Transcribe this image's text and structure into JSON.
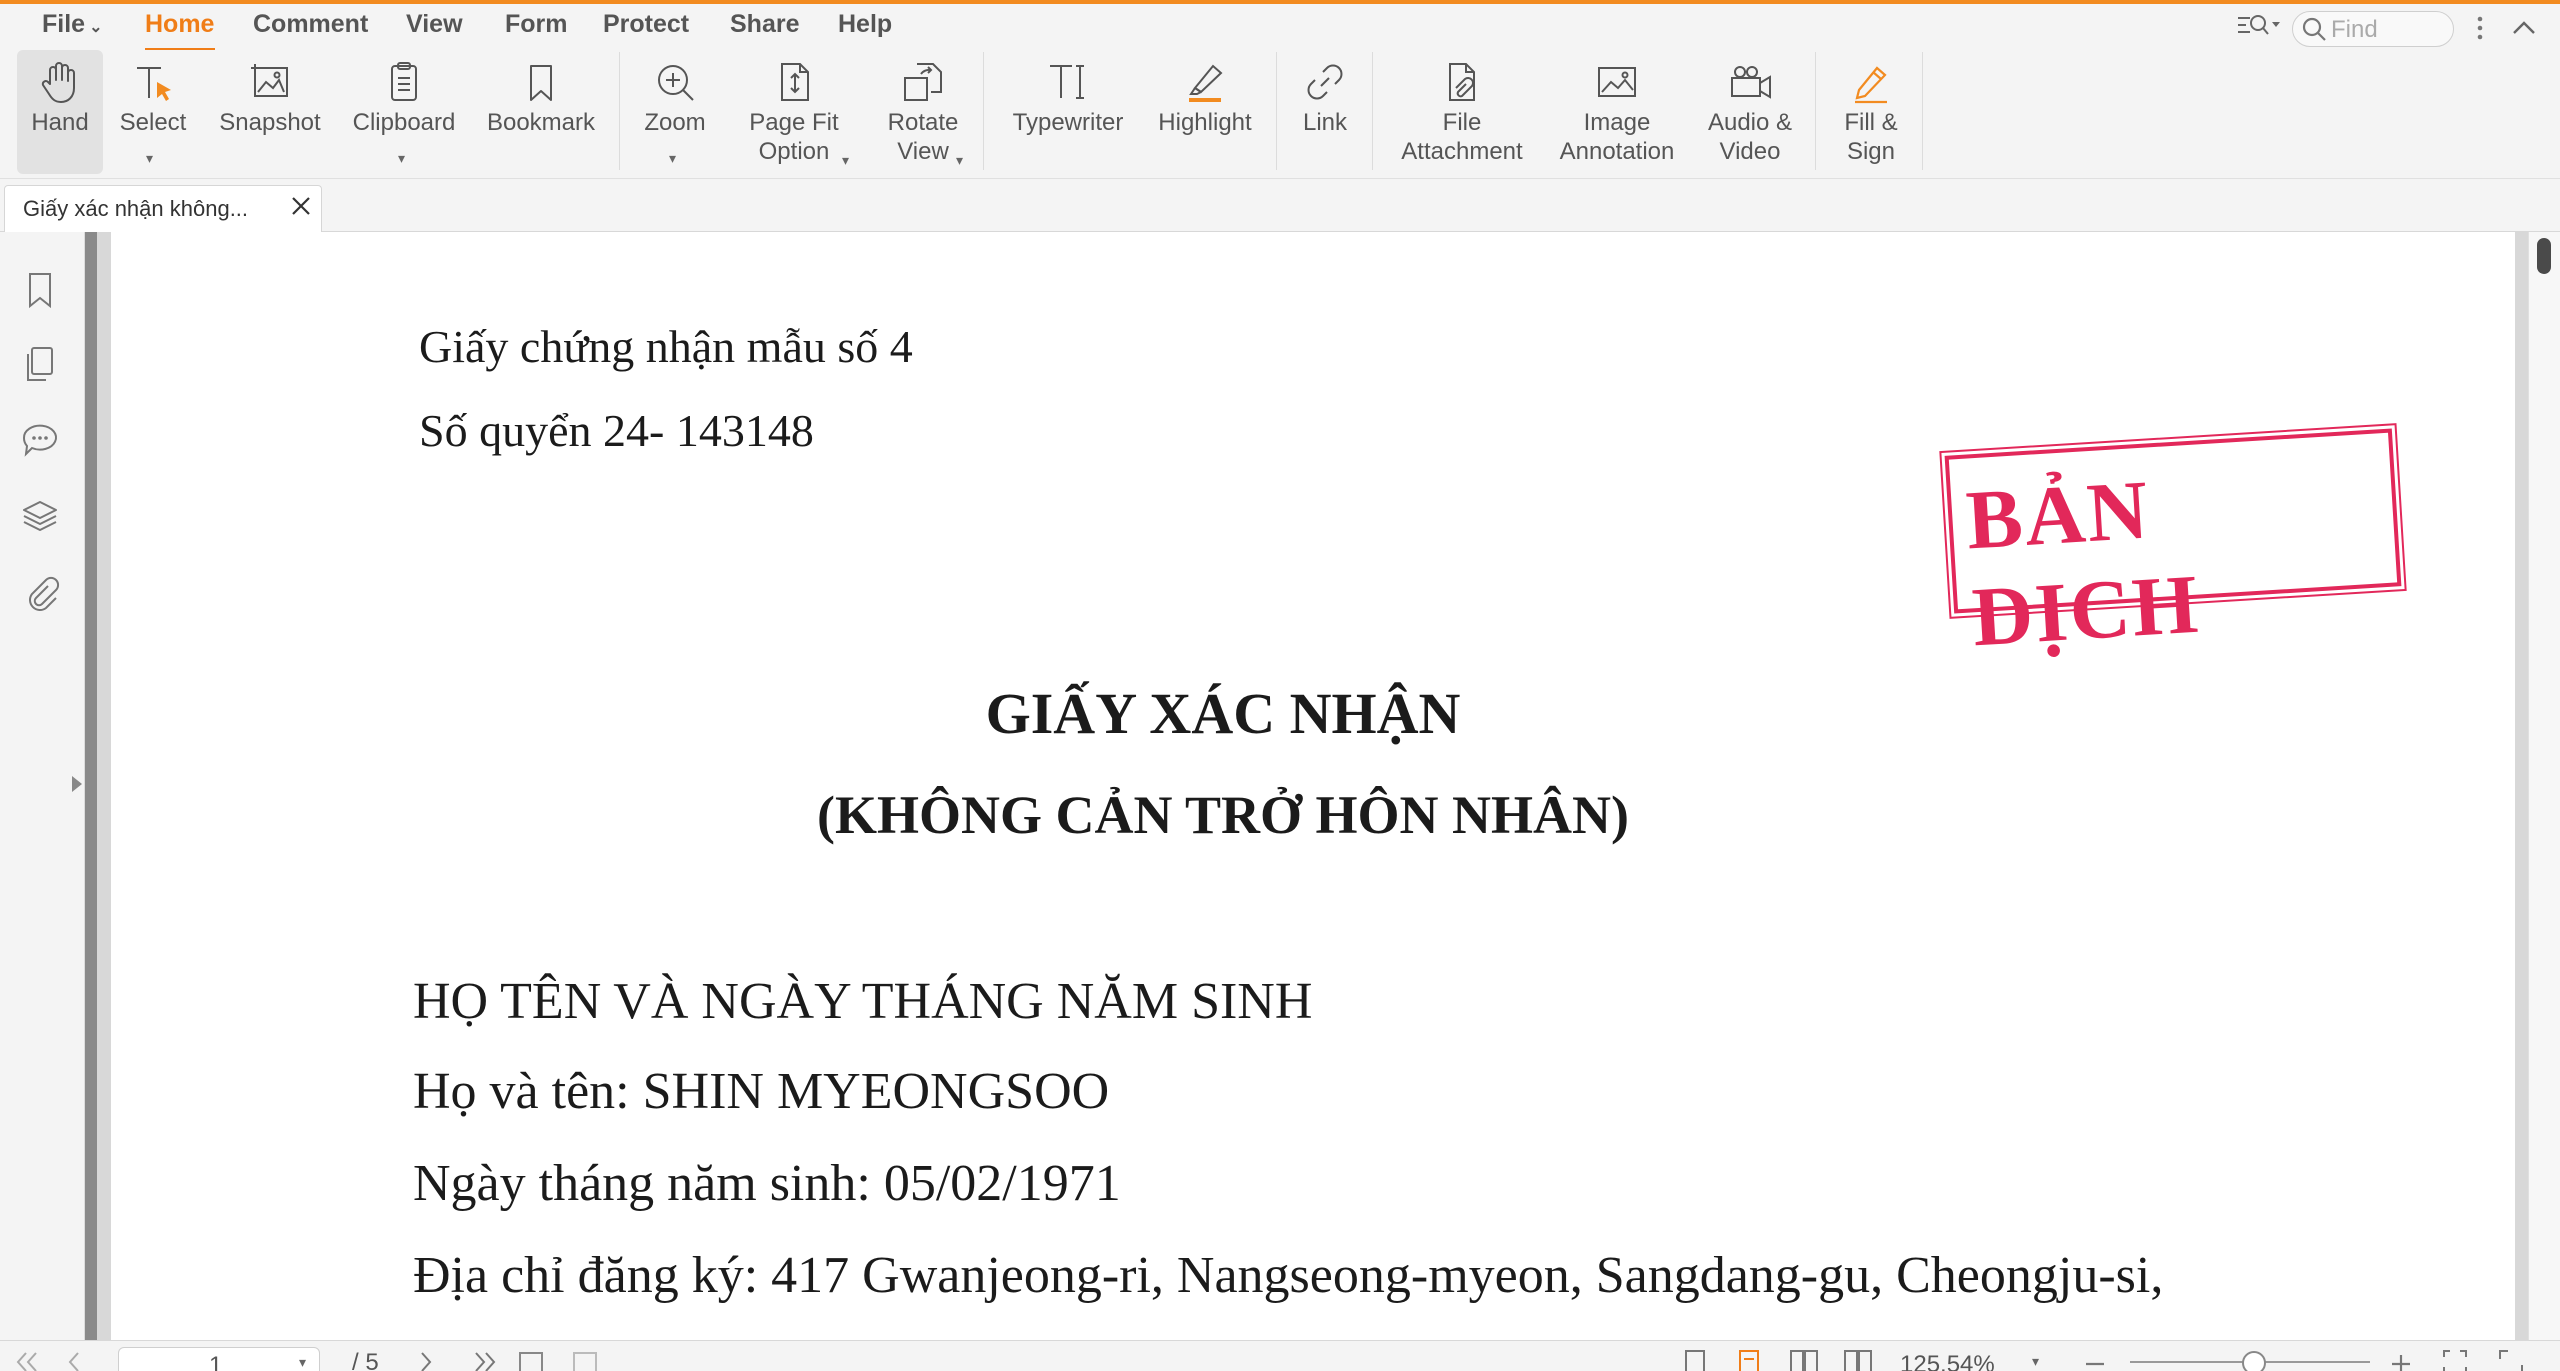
{
  "menu": {
    "file": "File",
    "items": [
      "Home",
      "Comment",
      "View",
      "Form",
      "Protect",
      "Share",
      "Help"
    ],
    "active": "Home"
  },
  "search": {
    "placeholder": "Find"
  },
  "ribbon": {
    "hand": "Hand",
    "select": "Select",
    "snapshot": "Snapshot",
    "clipboard": "Clipboard",
    "bookmark": "Bookmark",
    "zoom": "Zoom",
    "page_fit_1": "Page Fit",
    "page_fit_2": "Option",
    "rotate_1": "Rotate",
    "rotate_2": "View",
    "typewriter": "Typewriter",
    "highlight": "Highlight",
    "link": "Link",
    "file_attach_1": "File",
    "file_attach_2": "Attachment",
    "image_annot_1": "Image",
    "image_annot_2": "Annotation",
    "audio_1": "Audio &",
    "audio_2": "Video",
    "fill_sign_1": "Fill &",
    "fill_sign_2": "Sign"
  },
  "tab": {
    "title": "Giấy xác nhận không..."
  },
  "document": {
    "form_no": "Giấy chứng nhận mẫu số 4",
    "book_no": "Số quyển 24- 143148",
    "stamp": "BẢN DỊCH",
    "title": "GIẤY XÁC NHẬN",
    "subtitle": "(KHÔNG CẢN TRỞ HÔN NHÂN)",
    "section": "HỌ TÊN VÀ NGÀY THÁNG NĂM SINH",
    "name_line": "Họ và tên:  SHIN MYEONGSOO",
    "dob_line": "Ngày tháng năm sinh: 05/02/1971",
    "address_line": "Địa chỉ đăng ký: 417 Gwanjeong-ri, Nangseong-myeon, Sangdang-gu, Cheongju-si,"
  },
  "status": {
    "page_current": "1",
    "page_total": "/ 5",
    "zoom": "125.54%"
  },
  "colors": {
    "accent": "#f07d17",
    "stamp": "#e2285a"
  }
}
